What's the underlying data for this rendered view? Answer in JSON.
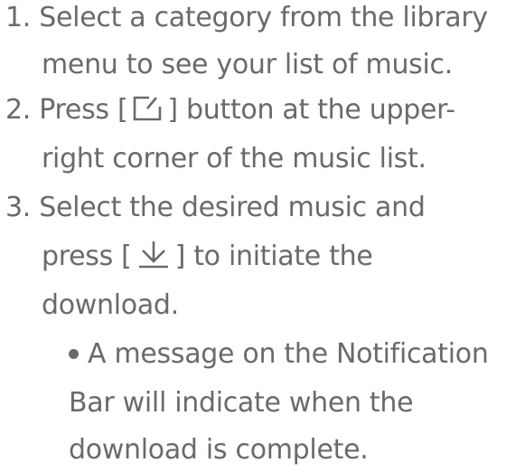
{
  "steps": [
    {
      "number": "1.",
      "line1": "Select a category from the library",
      "line2": "menu to see your list of music."
    },
    {
      "number": "2.",
      "line1_prefix": "Press [",
      "line1_suffix": "] button at the upper-",
      "icon": "edit-icon",
      "line2": "right corner of the music list."
    },
    {
      "number": "3.",
      "line1": "Select the desired music and",
      "line2_prefix": "press [",
      "line2_suffix": "] to initiate the",
      "icon": "download-icon",
      "line3": "download."
    }
  ],
  "note": {
    "line1": "A message on the Notification",
    "line2": "Bar will indicate when the",
    "line3": "download is complete."
  }
}
